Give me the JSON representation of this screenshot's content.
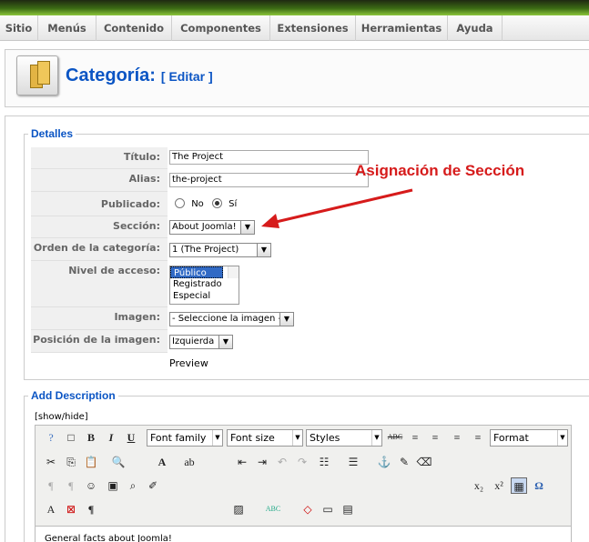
{
  "menu": [
    "Sitio",
    "Menús",
    "Contenido",
    "Componentes",
    "Extensiones",
    "Herramientas",
    "Ayuda"
  ],
  "page": {
    "title": "Categoría:",
    "action": "[ Editar ]"
  },
  "details": {
    "legend": "Detalles",
    "title_label": "Título:",
    "title_value": "The Project",
    "alias_label": "Alias:",
    "alias_value": "the-project",
    "published_label": "Publicado:",
    "no_label": "No",
    "yes_label": "Sí",
    "section_label": "Sección:",
    "section_value": "About Joomla!",
    "order_label": "Orden de la categoría:",
    "order_value": "1 (The Project)",
    "access_label": "Nivel de acceso:",
    "access_options": [
      "Público",
      "Registrado",
      "Especial"
    ],
    "image_label": "Imagen:",
    "image_value": "- Seleccione la imagen -",
    "imgpos_label": "Posición de la imagen:",
    "imgpos_value": "Izquierda",
    "preview": "Preview"
  },
  "annotation": "Asignación de Sección",
  "description": {
    "legend": "Add Description",
    "toggle": "[show/hide]",
    "font_family": "Font family",
    "font_size": "Font size",
    "styles": "Styles",
    "format": "Format",
    "content": "General facts about Joomla!"
  },
  "colors": {
    "accent": "#0b55c4",
    "annotation": "#d61b1b"
  }
}
